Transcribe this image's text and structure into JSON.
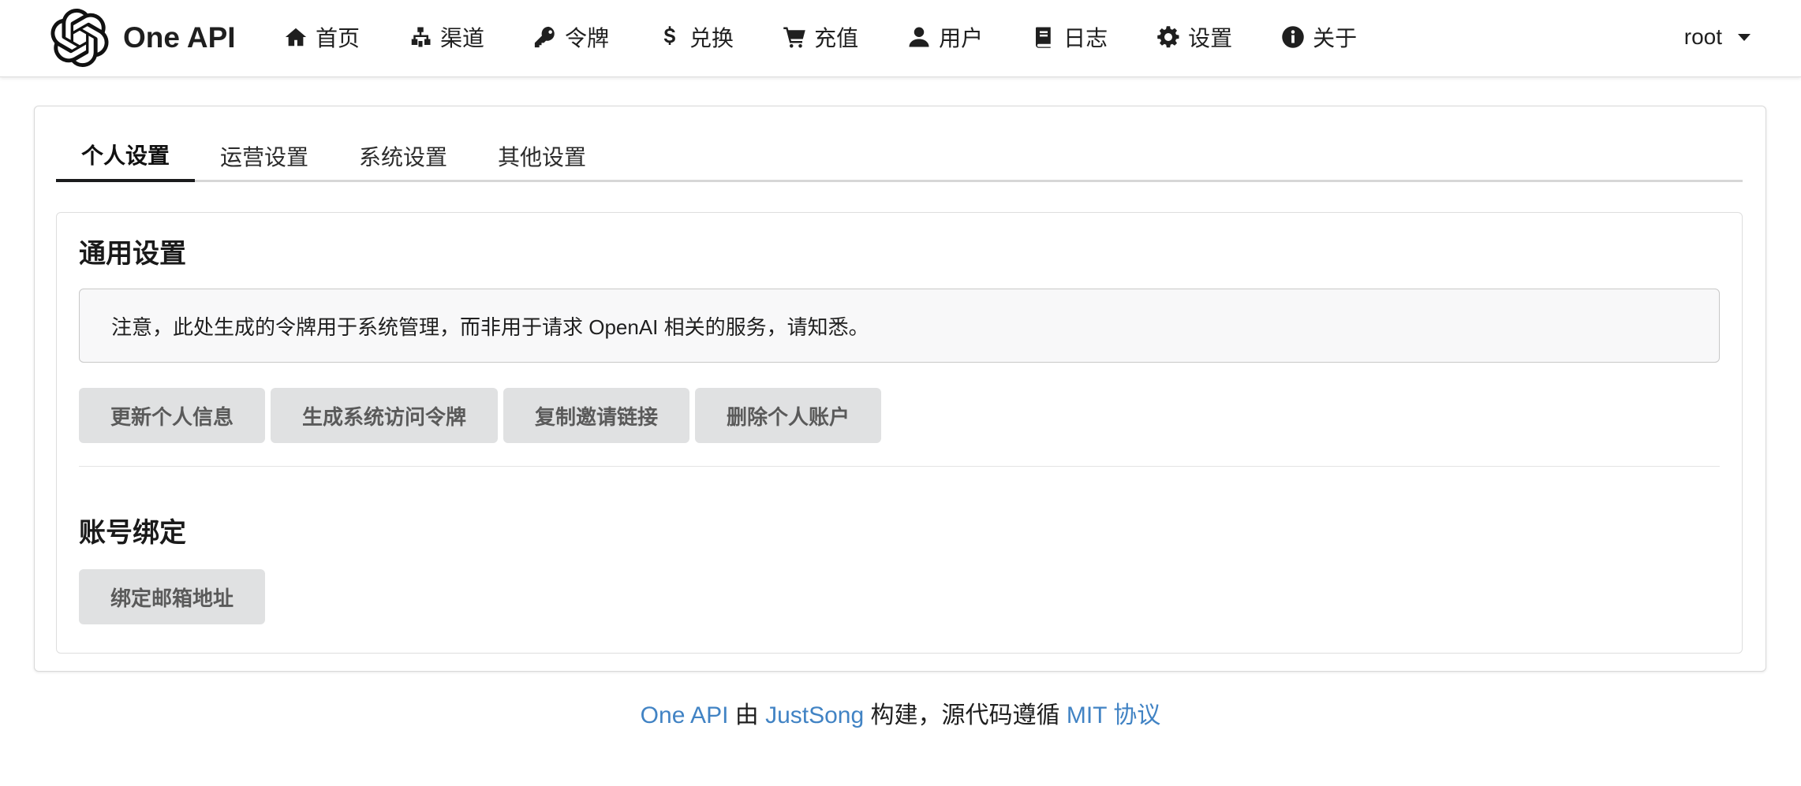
{
  "brand": {
    "name": "One API"
  },
  "nav": {
    "items": [
      {
        "label": "首页",
        "icon": "home-icon"
      },
      {
        "label": "渠道",
        "icon": "sitemap-icon"
      },
      {
        "label": "令牌",
        "icon": "key-icon"
      },
      {
        "label": "兑换",
        "icon": "dollar-icon"
      },
      {
        "label": "充值",
        "icon": "cart-icon"
      },
      {
        "label": "用户",
        "icon": "user-icon"
      },
      {
        "label": "日志",
        "icon": "book-icon"
      },
      {
        "label": "设置",
        "icon": "gear-icon"
      },
      {
        "label": "关于",
        "icon": "info-icon"
      }
    ],
    "user": "root"
  },
  "tabs": [
    {
      "label": "个人设置",
      "active": true
    },
    {
      "label": "运营设置",
      "active": false
    },
    {
      "label": "系统设置",
      "active": false
    },
    {
      "label": "其他设置",
      "active": false
    }
  ],
  "general": {
    "title": "通用设置",
    "notice": "注意，此处生成的令牌用于系统管理，而非用于请求 OpenAI 相关的服务，请知悉。",
    "buttons": {
      "update_profile": "更新个人信息",
      "generate_token": "生成系统访问令牌",
      "copy_invite": "复制邀请链接",
      "delete_account": "删除个人账户"
    }
  },
  "binding": {
    "title": "账号绑定",
    "bind_email": "绑定邮箱地址"
  },
  "footer": {
    "project": "One API",
    "by": " 由 ",
    "author": "JustSong",
    "middle": " 构建，源代码遵循 ",
    "license": "MIT 协议"
  },
  "colors": {
    "link": "#4183c4",
    "button_bg": "#e0e1e2",
    "active_tab_border": "#1b1c1d"
  }
}
